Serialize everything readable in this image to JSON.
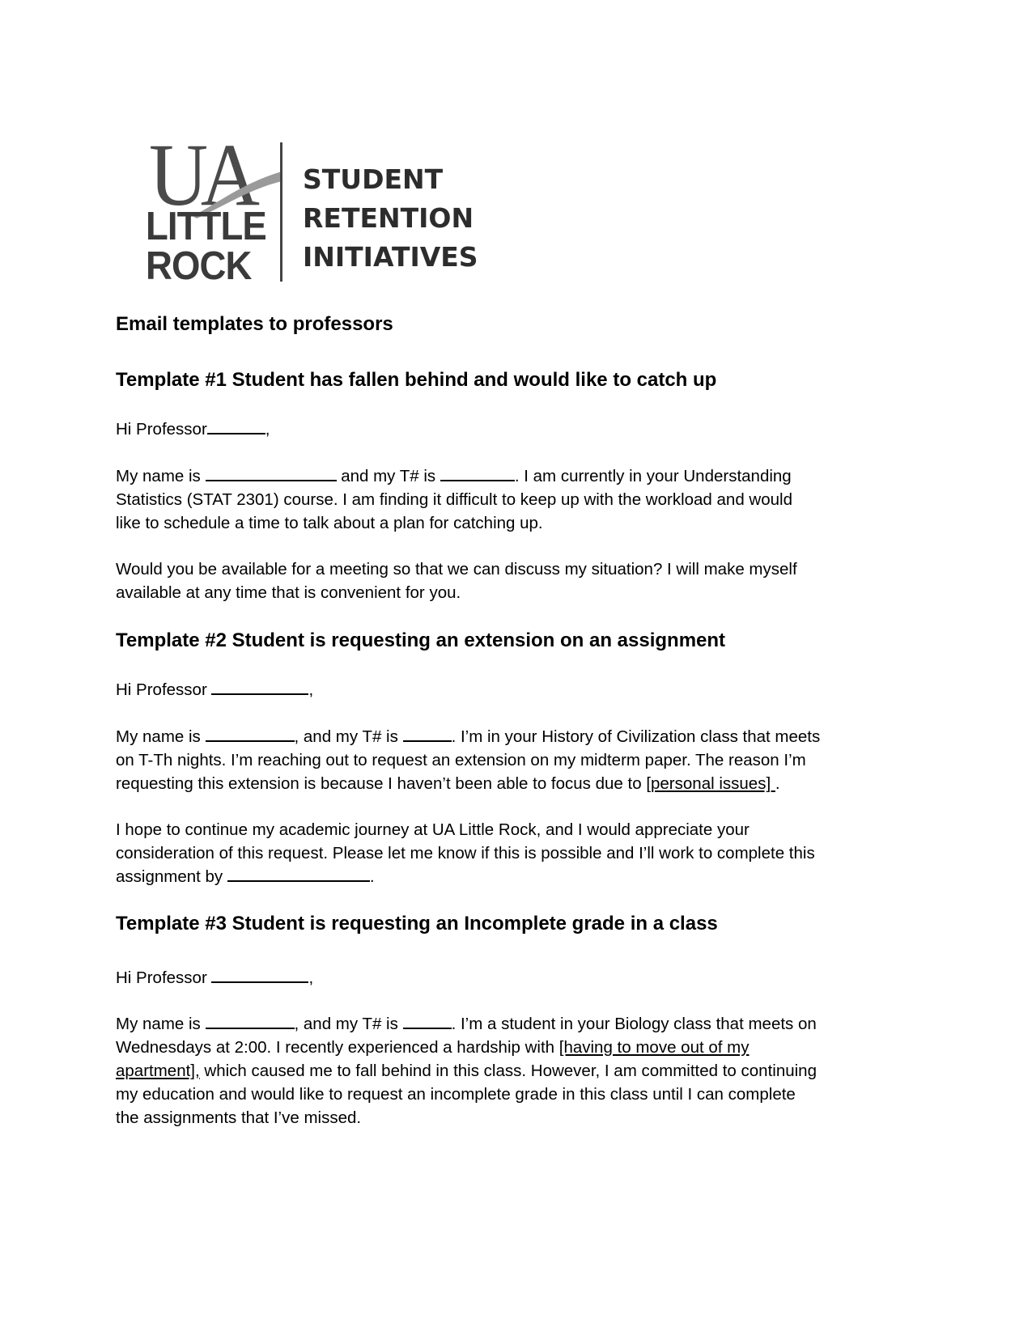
{
  "logo": {
    "mark_line1": "UA",
    "mark_line2": "LITTLE",
    "mark_line3": "ROCK",
    "text_lines": [
      "STUDENT",
      "RETENTION",
      "INITIATIVES"
    ]
  },
  "document": {
    "title": "Email templates to professors",
    "templates": [
      {
        "heading": "Template #1 Student has fallen behind and would like to catch up",
        "greeting": {
          "prefix": "Hi Professor",
          "suffix": ","
        },
        "para1": {
          "l1_a": "My name is ",
          "l1_b": " and my T# is ",
          "l1_c": ". I am currently in your Understanding",
          "l2": "Statistics (STAT 2301) course. I am finding it difficult to keep up with the workload and would",
          "l3": "like to schedule a time to talk about a plan for catching up."
        },
        "para2": {
          "l1": "Would you be available for a meeting so that we can discuss my situation? I will make myself",
          "l2": "available at any time that is convenient for you."
        }
      },
      {
        "heading": "Template #2 Student is requesting an extension on an assignment",
        "greeting": {
          "prefix": "Hi Professor ",
          "suffix": ","
        },
        "para1": {
          "l1_a": "My name is ",
          "l1_b": ", and my T# is ",
          "l1_c": ". I’m in your History of Civilization class that meets",
          "l2": "on T-Th nights. I’m reaching out to request an extension on my midterm paper. The reason I’m",
          "l3_a": "requesting this extension is because I haven’t been able to focus due to ",
          "l3_fill": " [personal issues] ",
          "l3_b": "."
        },
        "para2": {
          "l1": "I hope to continue my academic journey at UA Little Rock, and I would appreciate your",
          "l2": "consideration of this request. Please let me know if this is possible and I’ll work to complete this",
          "l3_a": "assignment by ",
          "l3_b": "."
        }
      },
      {
        "heading": "Template #3 Student is requesting an Incomplete grade in a class",
        "greeting": {
          "prefix": "Hi Professor ",
          "suffix": ","
        },
        "para1": {
          "l1_a": "My name is ",
          "l1_b": ", and my T# is ",
          "l1_c": ". I’m a student in your Biology class that meets on",
          "l2_a": "Wednesdays at 2:00. I recently experienced a hardship with ",
          "l2_fill": "[having to move out of my",
          "l3_fill": "apartment],",
          "l3_b": " which caused me to fall behind in this class. However, I am committed to continuing",
          "l4": "my education and would like to request an incomplete grade in this class until I can complete",
          "l5": "the assignments that I’ve missed."
        }
      }
    ]
  }
}
